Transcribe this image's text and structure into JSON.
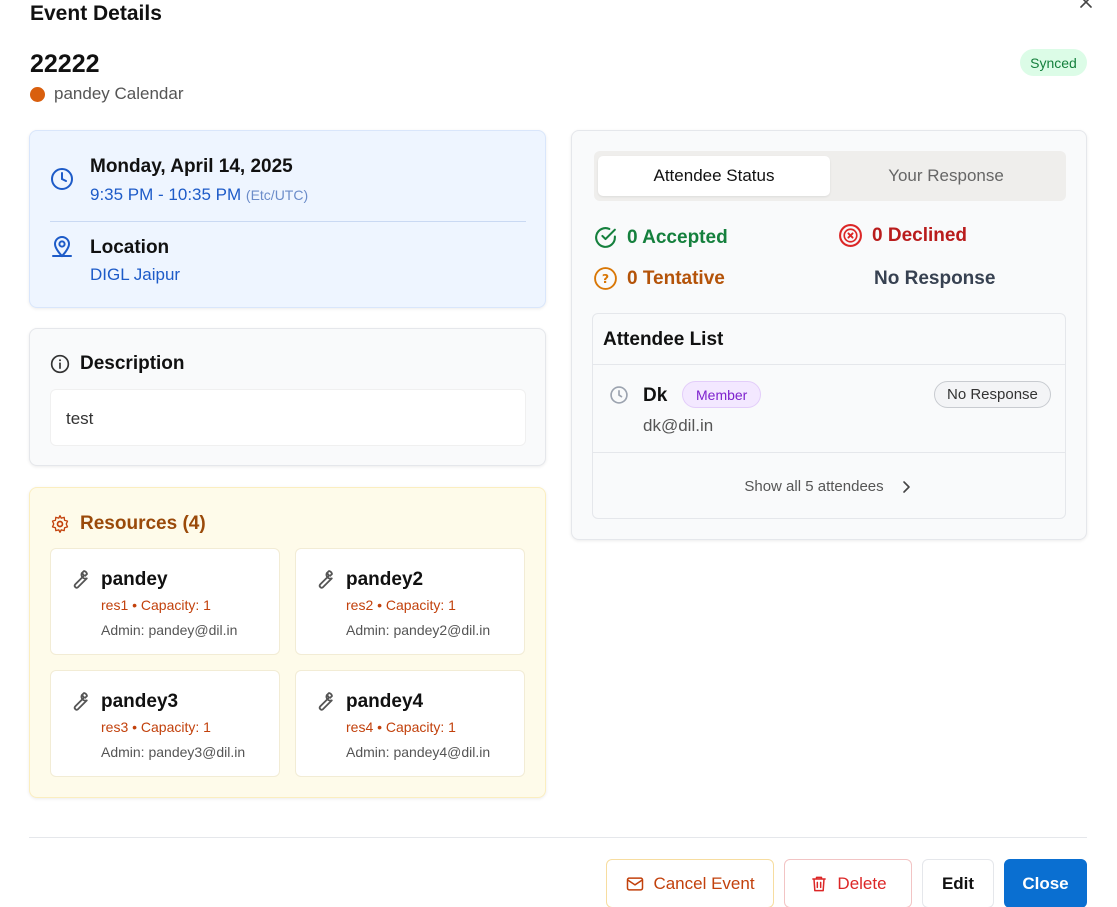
{
  "dialog": {
    "title": "Event Details",
    "close_icon": "close-icon"
  },
  "event": {
    "title": "22222",
    "calendar_name": "pandey Calendar",
    "calendar_color": "#d95f0e",
    "sync_status": "Synced"
  },
  "schedule": {
    "date": "Monday, April 14, 2025",
    "time_range": "9:35 PM - 10:35 PM",
    "timezone": "(Etc/UTC)",
    "location_label": "Location",
    "location_value": "DIGL Jaipur"
  },
  "description": {
    "label": "Description",
    "text": "test"
  },
  "resources": {
    "label": "Resources (4)",
    "items": [
      {
        "name": "pandey",
        "meta": "res1 • Capacity: 1",
        "admin": "Admin: pandey@dil.in"
      },
      {
        "name": "pandey2",
        "meta": "res2 • Capacity: 1",
        "admin": "Admin: pandey2@dil.in"
      },
      {
        "name": "pandey3",
        "meta": "res3 • Capacity: 1",
        "admin": "Admin: pandey3@dil.in"
      },
      {
        "name": "pandey4",
        "meta": "res4 • Capacity: 1",
        "admin": "Admin: pandey4@dil.in"
      }
    ]
  },
  "attendees": {
    "tabs": [
      {
        "label": "Attendee Status",
        "active": true
      },
      {
        "label": "Your Response",
        "active": false
      }
    ],
    "stats": {
      "accepted": "0 Accepted",
      "declined": "0 Declined",
      "tentative": "0 Tentative",
      "no_response": "No Response"
    },
    "list_title": "Attendee List",
    "list": [
      {
        "name": "Dk",
        "role": "Member",
        "email": "dk@dil.in",
        "status": "No Response"
      }
    ],
    "show_all_label": "Show all 5 attendees"
  },
  "footer": {
    "cancel_label": "Cancel Event",
    "delete_label": "Delete",
    "edit_label": "Edit",
    "close_label": "Close"
  },
  "colors": {
    "accent": "#0a6fd1",
    "accepted": "#15803d",
    "declined": "#b91c1c",
    "tentative": "#b45309",
    "resource_title": "#9a4a0a"
  }
}
